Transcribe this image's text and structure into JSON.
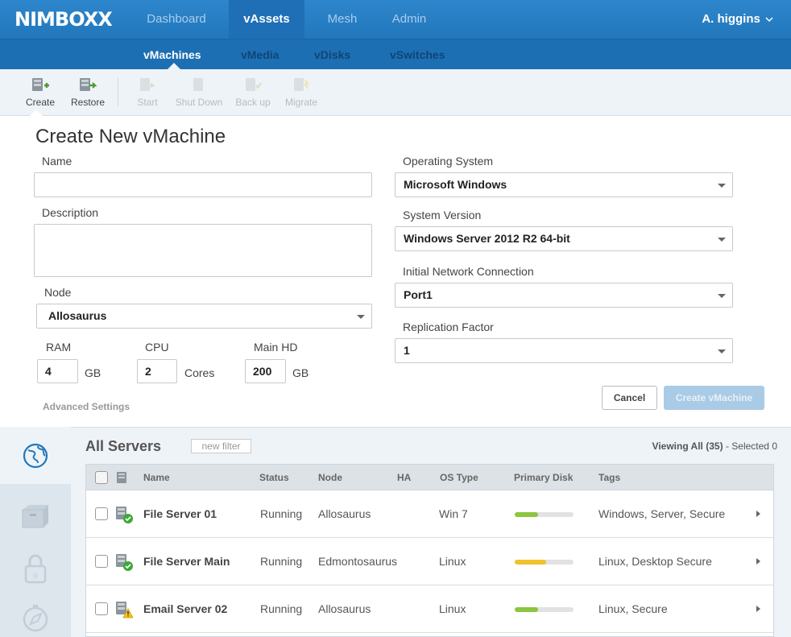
{
  "brand": {
    "logo": "NIMBOXX"
  },
  "nav": {
    "tabs": [
      {
        "label": "Dashboard"
      },
      {
        "label": "vAssets",
        "active": true
      },
      {
        "label": "Mesh"
      },
      {
        "label": "Admin"
      }
    ],
    "user": "A. higgins"
  },
  "subnav": {
    "tabs": [
      {
        "label": "vMachines",
        "active": true
      },
      {
        "label": "vMedia"
      },
      {
        "label": "vDisks"
      },
      {
        "label": "vSwitches"
      }
    ]
  },
  "toolbar": {
    "create": "Create",
    "restore": "Restore",
    "start": "Start",
    "shutdown": "Shut Down",
    "backup": "Back up",
    "migrate": "Migrate"
  },
  "form": {
    "title": "Create New vMachine",
    "name_label": "Name",
    "name_value": "",
    "description_label": "Description",
    "description_value": "",
    "node_label": "Node",
    "node_value": "Allosaurus",
    "ram_label": "RAM",
    "ram_value": "4",
    "ram_unit": "GB",
    "cpu_label": "CPU",
    "cpu_value": "2",
    "cpu_unit": "Cores",
    "hd_label": "Main HD",
    "hd_value": "200",
    "hd_unit": "GB",
    "advanced": "Advanced Settings",
    "os_label": "Operating System",
    "os_value": "Microsoft Windows",
    "version_label": "System Version",
    "version_value": "Windows Server 2012 R2 64-bit",
    "network_label": "Initial Network Connection",
    "network_value": "Port1",
    "replication_label": "Replication Factor",
    "replication_value": "1",
    "cancel": "Cancel",
    "create": "Create vMachine"
  },
  "servers": {
    "title": "All Servers",
    "filter": "new filter",
    "viewing_label": "Viewing All",
    "viewing_count": "(35)",
    "separator": "-",
    "selected": "Selected 0",
    "columns": [
      "Name",
      "Status",
      "Node",
      "HA",
      "OS Type",
      "Primary Disk",
      "Tags"
    ],
    "rows": [
      {
        "name": "File Server 01",
        "status": "Running",
        "node": "Allosaurus",
        "ha": "",
        "os": "Win 7",
        "disk": 0.4,
        "disk_color": "#8cc63f",
        "tags": "Windows, Server, Secure",
        "health": "ok"
      },
      {
        "name": "File Server Main",
        "status": "Running",
        "node": "Edmontosaurus",
        "ha": "",
        "os": "Linux",
        "disk": 0.54,
        "disk_color": "#f2c12e",
        "tags": "Linux, Desktop Secure",
        "health": "ok"
      },
      {
        "name": "Email Server 02",
        "status": "Running",
        "node": "Allosaurus",
        "ha": "",
        "os": "Linux",
        "disk": 0.4,
        "disk_color": "#8cc63f",
        "tags": "Linux, Secure",
        "health": "warning"
      }
    ]
  },
  "colors": {
    "brand_blue": "#2277bb",
    "subnav_blue": "#1d6fb3",
    "ok_green": "#3aaa35",
    "warn_yellow": "#f5c518"
  }
}
